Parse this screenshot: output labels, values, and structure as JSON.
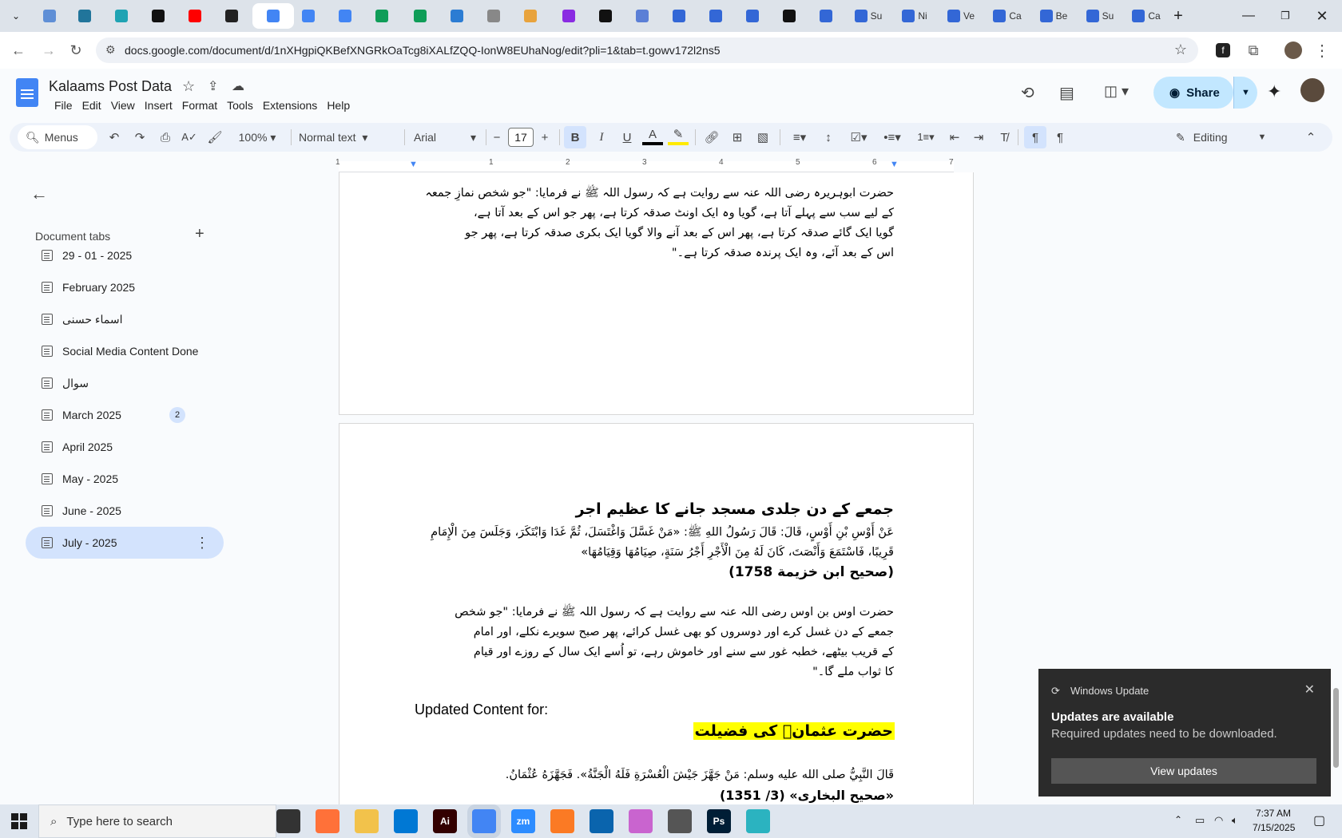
{
  "browser": {
    "tabs": [
      {
        "icon": "globe-icon",
        "color": "#5f8fd6",
        "title": ""
      },
      {
        "icon": "wordpress-icon",
        "color": "#21759b",
        "title": ""
      },
      {
        "icon": "app-icon",
        "color": "#1fa3b3",
        "title": ""
      },
      {
        "icon": "openai-icon",
        "color": "#111111",
        "title": ""
      },
      {
        "icon": "youtube-icon",
        "color": "#ff0000",
        "title": ""
      },
      {
        "icon": "bolt-icon",
        "color": "#222222",
        "title": ""
      },
      {
        "icon": "docs-icon",
        "color": "#4285f4",
        "title": ""
      },
      {
        "icon": "docs-icon",
        "color": "#4285f4",
        "title": ""
      },
      {
        "icon": "docs-icon",
        "color": "#4285f4",
        "title": ""
      },
      {
        "icon": "sheets-icon",
        "color": "#0f9d58",
        "title": ""
      },
      {
        "icon": "sheets-icon",
        "color": "#0f9d58",
        "title": ""
      },
      {
        "icon": "word-icon",
        "color": "#2b7cd3",
        "title": ""
      },
      {
        "icon": "globe-icon",
        "color": "#888888",
        "title": ""
      },
      {
        "icon": "app-icon",
        "color": "#e8a33d",
        "title": ""
      },
      {
        "icon": "code-icon",
        "color": "#8a2be2",
        "title": ""
      },
      {
        "icon": "ai-icon",
        "color": "#111111",
        "title": ""
      },
      {
        "icon": "grid-icon",
        "color": "#5b7fd6",
        "title": ""
      },
      {
        "icon": "forms-icon",
        "color": "#3367d6",
        "title": ""
      },
      {
        "icon": "forms-icon",
        "color": "#3367d6",
        "title": ""
      },
      {
        "icon": "forms-icon",
        "color": "#3367d6",
        "title": ""
      },
      {
        "icon": "m-icon",
        "color": "#111111",
        "title": ""
      },
      {
        "icon": "forms-icon",
        "color": "#3367d6",
        "title": ""
      },
      {
        "icon": "forms-icon",
        "color": "#3367d6",
        "title": "Su"
      },
      {
        "icon": "forms-icon",
        "color": "#3367d6",
        "title": "Ni"
      },
      {
        "icon": "forms-icon",
        "color": "#3367d6",
        "title": "Ve"
      },
      {
        "icon": "forms-icon",
        "color": "#3367d6",
        "title": "Ca"
      },
      {
        "icon": "forms-icon",
        "color": "#3367d6",
        "title": "Be"
      },
      {
        "icon": "forms-icon",
        "color": "#3367d6",
        "title": "Su"
      },
      {
        "icon": "forms-icon",
        "color": "#3367d6",
        "title": "Ca"
      }
    ],
    "url": "docs.google.com/document/d/1nXHgpiQKBefXNGRkOaTcg8iXALfZQQ-IonW8EUhaNog/edit?pli=1&tab=t.gowv172l2ns5"
  },
  "docs": {
    "title": "Kalaams Post Data",
    "menu": [
      "File",
      "Edit",
      "View",
      "Insert",
      "Format",
      "Tools",
      "Extensions",
      "Help"
    ],
    "share_label": "Share",
    "toolbar": {
      "menus_label": "Menus",
      "zoom": "100%",
      "style": "Normal text",
      "font": "Arial",
      "font_size": "17",
      "mode": "Editing"
    },
    "ruler_numbers": [
      "1",
      "1",
      "2",
      "3",
      "4",
      "5",
      "6",
      "7"
    ]
  },
  "sidebar": {
    "heading": "Document tabs",
    "tabs": [
      {
        "label": "29 - 01 - 2025"
      },
      {
        "label": "February 2025"
      },
      {
        "label": "اسماء حسنی"
      },
      {
        "label": "Social Media Content Done"
      },
      {
        "label": "سوال"
      },
      {
        "label": "March 2025",
        "badge": "2"
      },
      {
        "label": "April 2025"
      },
      {
        "label": "May - 2025"
      },
      {
        "label": "June - 2025"
      },
      {
        "label": "July - 2025",
        "active": true
      }
    ]
  },
  "page1": {
    "lines": [
      "حضرت ابوہریرہ رضی اللہ عنہ سے روایت ہے کہ رسول اللہ ﷺ نے فرمایا: \"جو شخص نمازِ جمعہ",
      "کے لیے سب سے پہلے آتا ہے، گویا وہ ایک اونٹ صدقہ کرتا ہے، پھر جو اس کے بعد آتا ہے،",
      "گویا ایک گائے صدقہ کرتا ہے، پھر اس کے بعد آنے والا گویا ایک بکری صدقہ کرتا ہے، پھر جو",
      "اس کے بعد آئے، وہ ایک پرندہ صدقہ کرتا ہے۔\""
    ]
  },
  "page2": {
    "heading": "جمعے کے دن جلدی مسجد جانے کا عظیم اجر",
    "arabic_lines": [
      "عَنْ أَوْسِ بْنِ أَوْسٍ، قَالَ: قَالَ رَسُولُ اللهِ ﷺ: «مَنْ غَسَّلَ وَاغْتَسَلَ، ثُمَّ غَدَا وَابْتَكَرَ، وَجَلَسَ مِنَ الْإِمَامِ",
      "قَرِيبًا، فَاسْتَمَعَ وَأَنْصَتَ، كَانَ لَهُ مِنَ الْأَجْرِ أَجْرُ سَنَةٍ، صِيَامُهَا وَقِيَامُهَا»"
    ],
    "reference1": "(صحیح ابن خزیمة 1758)",
    "urdu_lines": [
      "حضرت اوس بن اوس رضی اللہ عنہ سے روایت ہے کہ رسول اللہ ﷺ نے فرمایا: \"جو شخص",
      "جمعے کے دن غسل کرے اور دوسروں کو بھی غسل کرائے، پھر صبح سویرے نکلے، اور امام",
      "کے قریب بیٹھے، خطبہ غور سے سنے اور خاموش رہے، تو اُسے ایک سال کے روزے اور قیام",
      "کا ثواب ملے گا۔\""
    ],
    "updated_label": "Updated Content for:",
    "highlight_heading": "حضرت عثمانؓ کی فضیلت",
    "hadith_line": "قَالَ النَّبِيُّ صلى الله عليه وسلم: مَنْ جَهَّزَ جَيْشَ الْعُسْرَةِ فَلَهُ الْجَنَّةُ». فَجَهَّزَهُ عُثْمَانُ.",
    "reference2": "«صحیح البخاری» (3/ 1351)"
  },
  "notification": {
    "app": "Windows Update",
    "heading": "Updates are available",
    "body": "Required updates need to be downloaded.",
    "button": "View updates"
  },
  "taskbar": {
    "search_placeholder": "Type here to search",
    "apps": [
      {
        "icon": "task-view-icon",
        "color": "#333333",
        "label": ""
      },
      {
        "icon": "firefox-icon",
        "color": "#ff7139",
        "label": ""
      },
      {
        "icon": "folder-icon",
        "color": "#f2c24b",
        "label": ""
      },
      {
        "icon": "vscode-icon",
        "color": "#0078d4",
        "label": ""
      },
      {
        "icon": "illustrator-icon",
        "color": "#330000",
        "label": "Ai"
      },
      {
        "icon": "chrome-icon",
        "color": "#4285f4",
        "label": ""
      },
      {
        "icon": "zoom-icon",
        "color": "#2d8cff",
        "label": "zm"
      },
      {
        "icon": "xampp-icon",
        "color": "#fb7a24",
        "label": ""
      },
      {
        "icon": "outlook-icon",
        "color": "#0a64ad",
        "label": ""
      },
      {
        "icon": "photos-icon",
        "color": "#c964cf",
        "label": ""
      },
      {
        "icon": "pen-icon",
        "color": "#555555",
        "label": ""
      },
      {
        "icon": "photoshop-icon",
        "color": "#001e36",
        "label": "Ps"
      },
      {
        "icon": "app-icon",
        "color": "#2bb3c0",
        "label": ""
      }
    ],
    "time": "7:37 AM",
    "date": "7/15/2025"
  }
}
